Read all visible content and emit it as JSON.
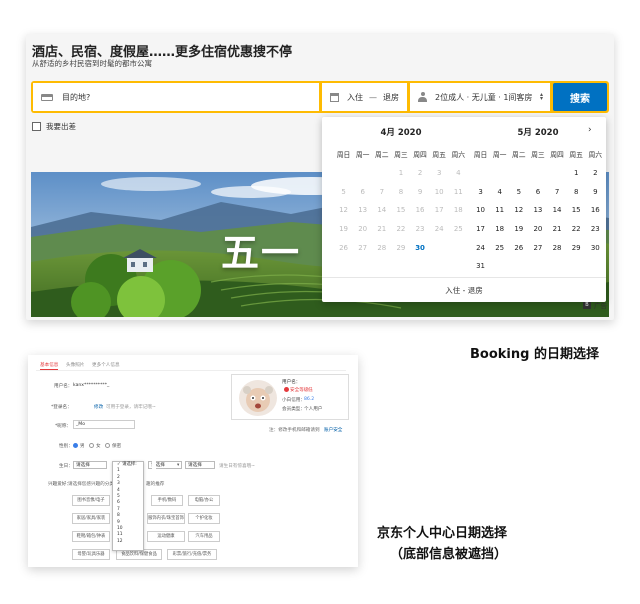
{
  "booking": {
    "title": "酒店、民宿、度假屋……更多住宿优惠搜不停",
    "subtitle": "从舒适的乡村民宿到时髦的都市公寓",
    "search": {
      "destination_placeholder": "目的地?",
      "checkin_label": "入住",
      "separator": "—",
      "checkout_label": "退房",
      "guests_value": "2位成人 · 无儿童 · 1间客房",
      "search_button": "搜索"
    },
    "business_trip_label": "我要出差",
    "hero_text": "五一",
    "hero_text_partial": "𝓉",
    "ad_label": "广告",
    "ad_badge": "B",
    "calendar": {
      "weekdays": [
        "周日",
        "周一",
        "周二",
        "周三",
        "周四",
        "周五",
        "周六"
      ],
      "months": [
        {
          "title": "4月 2020",
          "cells": [
            {
              "d": "",
              "s": ""
            },
            {
              "d": "",
              "s": ""
            },
            {
              "d": "",
              "s": ""
            },
            {
              "d": "1",
              "s": "past"
            },
            {
              "d": "2",
              "s": "past"
            },
            {
              "d": "3",
              "s": "past"
            },
            {
              "d": "4",
              "s": "past"
            },
            {
              "d": "5",
              "s": "past"
            },
            {
              "d": "6",
              "s": "past"
            },
            {
              "d": "7",
              "s": "past"
            },
            {
              "d": "8",
              "s": "past"
            },
            {
              "d": "9",
              "s": "past"
            },
            {
              "d": "10",
              "s": "past"
            },
            {
              "d": "11",
              "s": "past"
            },
            {
              "d": "12",
              "s": "past"
            },
            {
              "d": "13",
              "s": "past"
            },
            {
              "d": "14",
              "s": "past"
            },
            {
              "d": "15",
              "s": "past"
            },
            {
              "d": "16",
              "s": "past"
            },
            {
              "d": "17",
              "s": "past"
            },
            {
              "d": "18",
              "s": "past"
            },
            {
              "d": "19",
              "s": "past"
            },
            {
              "d": "20",
              "s": "past"
            },
            {
              "d": "21",
              "s": "past"
            },
            {
              "d": "22",
              "s": "past"
            },
            {
              "d": "23",
              "s": "past"
            },
            {
              "d": "24",
              "s": "past"
            },
            {
              "d": "25",
              "s": "past"
            },
            {
              "d": "26",
              "s": "past"
            },
            {
              "d": "27",
              "s": "past"
            },
            {
              "d": "28",
              "s": "past"
            },
            {
              "d": "29",
              "s": "past"
            },
            {
              "d": "30",
              "s": "today"
            }
          ]
        },
        {
          "title": "5月 2020",
          "cells": [
            {
              "d": "",
              "s": ""
            },
            {
              "d": "",
              "s": ""
            },
            {
              "d": "",
              "s": ""
            },
            {
              "d": "",
              "s": ""
            },
            {
              "d": "",
              "s": ""
            },
            {
              "d": "1",
              "s": "avail"
            },
            {
              "d": "2",
              "s": "avail"
            },
            {
              "d": "3",
              "s": "avail"
            },
            {
              "d": "4",
              "s": "avail"
            },
            {
              "d": "5",
              "s": "avail"
            },
            {
              "d": "6",
              "s": "avail"
            },
            {
              "d": "7",
              "s": "avail"
            },
            {
              "d": "8",
              "s": "avail"
            },
            {
              "d": "9",
              "s": "avail"
            },
            {
              "d": "10",
              "s": "avail"
            },
            {
              "d": "11",
              "s": "avail"
            },
            {
              "d": "12",
              "s": "avail"
            },
            {
              "d": "13",
              "s": "avail"
            },
            {
              "d": "14",
              "s": "avail"
            },
            {
              "d": "15",
              "s": "avail"
            },
            {
              "d": "16",
              "s": "avail"
            },
            {
              "d": "17",
              "s": "avail"
            },
            {
              "d": "18",
              "s": "avail"
            },
            {
              "d": "19",
              "s": "avail"
            },
            {
              "d": "20",
              "s": "avail"
            },
            {
              "d": "21",
              "s": "avail"
            },
            {
              "d": "22",
              "s": "avail"
            },
            {
              "d": "23",
              "s": "avail"
            },
            {
              "d": "24",
              "s": "avail"
            },
            {
              "d": "25",
              "s": "avail"
            },
            {
              "d": "26",
              "s": "avail"
            },
            {
              "d": "27",
              "s": "avail"
            },
            {
              "d": "28",
              "s": "avail"
            },
            {
              "d": "29",
              "s": "avail"
            },
            {
              "d": "30",
              "s": "avail"
            },
            {
              "d": "31",
              "s": "avail"
            }
          ]
        }
      ],
      "footer": "入住 - 退房"
    }
  },
  "captions": {
    "booking": "Booking 的日期选择",
    "jd_line1": "京东个人中心日期选择",
    "jd_line2": "（底部信息被遮挡）"
  },
  "jd": {
    "tabs": [
      "基本信息",
      "头像照片",
      "更多个人信息"
    ],
    "username_label": "用户名：",
    "username_value": "kanx**********_",
    "login_label": "*登录名：",
    "login_action": "修改",
    "login_hint": "可用于登录，请牢记哦~",
    "nickname_label": "*昵称：",
    "nickname_value": "_Mo",
    "gender_label": "性别：",
    "gender_options": [
      "男",
      "女",
      "保密"
    ],
    "birthday_label": "生日：",
    "birthday_select": "请选择",
    "birthday_hint": "请生日有惊喜哦~",
    "interest_label": "兴趣爱好：",
    "interest_hint": "请选择您感兴趣的分类，给您",
    "interest_hint_end": "趣的推荐",
    "dropdown_options": [
      "✓ 请选择:",
      "1",
      "2",
      "3",
      "4",
      "5",
      "6",
      "7",
      "8",
      "9",
      "10",
      "11",
      "12"
    ],
    "tags": [
      [
        "图书音像/电子",
        "",
        "手机/数码",
        "电脑/办公"
      ],
      [
        "家居/家具/家装",
        "",
        "个护化妆",
        "",
        ""
      ],
      [
        "鞋靴/箱包/钟表",
        "",
        "汽车用品",
        ""
      ],
      [
        "母婴/玩具乐器",
        "食品饮料/保健食品",
        "彩票/旅行/充值/票务"
      ]
    ],
    "tags_mid": [
      "厨具",
      "服饰内衣/珠宝首饰",
      "运动健康"
    ],
    "profile": {
      "user_label": "用户名：",
      "security_label": "安全等级",
      "security_value": "低",
      "credit_label": "小白信用：",
      "credit_value": "86.2",
      "member_label": "会员类型：",
      "member_value": "个人用户"
    },
    "note": "注：修改手机和邮箱请到",
    "note_link": "账户安全"
  }
}
